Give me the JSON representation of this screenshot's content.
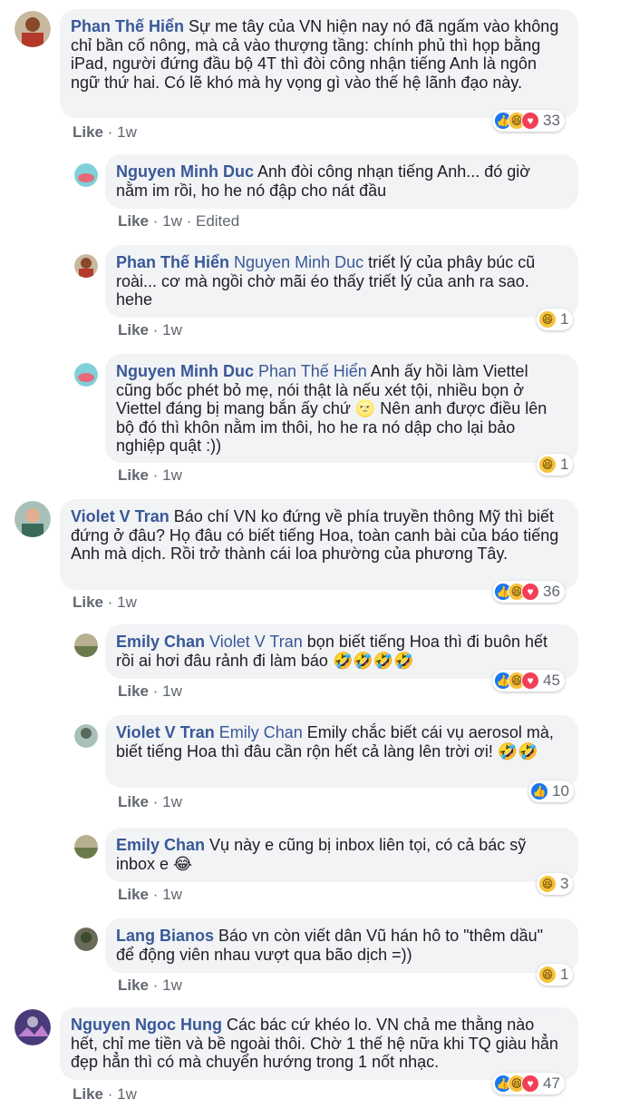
{
  "comments": [
    {
      "author": "Phan Thế Hiển",
      "mention": "",
      "text": "Sự me tây của VN hiện nay nó đã ngấm vào không chỉ bần cố nông, mà cả vào thượng tầng: chính phủ thì họp bằng iPad, người đứng đầu bộ 4T thì đòi công nhận tiếng Anh là ngôn ngữ thứ hai. Có lẽ khó mà hy vọng gì vào thế hệ lãnh đạo này.",
      "like": "Like",
      "time": "1w",
      "edited": "",
      "reaction_count": "33",
      "reactions": [
        "like",
        "haha",
        "love"
      ],
      "avatar_color": "#b35a3a"
    },
    {
      "author": "Nguyen Minh Duc",
      "mention": "",
      "text": "Anh đòi công nhạn tiếng Anh... đó giờ nằm im rồi, ho he nó đập cho nát đầu",
      "like": "Like",
      "time": "1w",
      "edited": "Edited",
      "reaction_count": "",
      "reactions": [],
      "avatar_color": "#3aa6b3"
    },
    {
      "author": "Phan Thế Hiển",
      "mention": "Nguyen Minh Duc",
      "text": "triết lý của phây búc cũ roài... cơ mà ngồi chờ mãi éo thấy triết lý của anh ra sao. hehe",
      "like": "Like",
      "time": "1w",
      "edited": "",
      "reaction_count": "1",
      "reactions": [
        "haha"
      ],
      "avatar_color": "#b35a3a"
    },
    {
      "author": "Nguyen Minh Duc",
      "mention": "Phan Thế Hiển",
      "text": "Anh ấy hồi làm Viettel cũng bốc phét bỏ mẹ, nói thật là nếu xét tội, nhiều bọn ở Viettel đáng bị mang bắn ấy chứ 🌝 Nên anh được điều lên bộ đó thì khôn nằm im thôi, ho he ra nó dập cho lại bảo nghiệp quật :))",
      "like": "Like",
      "time": "1w",
      "edited": "",
      "reaction_count": "1",
      "reactions": [
        "haha"
      ],
      "avatar_color": "#3aa6b3"
    },
    {
      "author": "Violet V Tran",
      "mention": "",
      "text": "Báo chí VN ko đứng về phía truyền thông Mỹ thì biết đứng ở đâu? Họ đâu có biết tiếng Hoa, toàn canh bài của báo tiếng Anh mà dịch. Rồi trở thành cái loa phường của phương Tây.",
      "like": "Like",
      "time": "1w",
      "edited": "",
      "reaction_count": "36",
      "reactions": [
        "like",
        "haha",
        "love"
      ],
      "avatar_color": "#6b8f8a"
    },
    {
      "author": "Emily Chan",
      "mention": "Violet V Tran",
      "text": "bọn biết tiếng Hoa thì đi buôn hết rồi ai hơi đâu rảnh đi làm báo 🤣🤣🤣🤣",
      "like": "Like",
      "time": "1w",
      "edited": "",
      "reaction_count": "45",
      "reactions": [
        "like",
        "haha",
        "love"
      ],
      "avatar_color": "#7d7a5a"
    },
    {
      "author": "Violet V Tran",
      "mention": "Emily Chan",
      "text": "Emily chắc biết cái vụ aerosol mà, biết tiếng Hoa thì đâu cần rộn hết cả làng lên trời ơi! 🤣🤣",
      "like": "Like",
      "time": "1w",
      "edited": "",
      "reaction_count": "10",
      "reactions": [
        "like"
      ],
      "avatar_color": "#6b8f8a"
    },
    {
      "author": "Emily Chan",
      "mention": "",
      "text": "Vụ này e cũng bị inbox liên tọi, có cả bác sỹ inbox e 😂",
      "like": "Like",
      "time": "1w",
      "edited": "",
      "reaction_count": "3",
      "reactions": [
        "haha"
      ],
      "avatar_color": "#7d7a5a"
    },
    {
      "author": "Lang Bianos",
      "mention": "",
      "text": "Báo vn còn viết dân Vũ hán hô to \"thêm dầu\" để động viên nhau vượt qua bão dịch =))",
      "like": "Like",
      "time": "1w",
      "edited": "",
      "reaction_count": "1",
      "reactions": [
        "haha"
      ],
      "avatar_color": "#4a5a3a"
    },
    {
      "author": "Nguyen Ngoc Hung",
      "mention": "",
      "text": "Các bác cứ khéo lo. VN chả me thằng nào hết, chỉ me tiền và bề ngoài thôi. Chờ 1 thế hệ nữa khi TQ giàu hẳn đẹp hẳn thì có mà chuyển hướng trong 1 nốt nhạc.",
      "like": "Like",
      "time": "1w",
      "edited": "",
      "reaction_count": "47",
      "reactions": [
        "like",
        "haha",
        "love"
      ],
      "avatar_color": "#5a4a8a"
    }
  ]
}
